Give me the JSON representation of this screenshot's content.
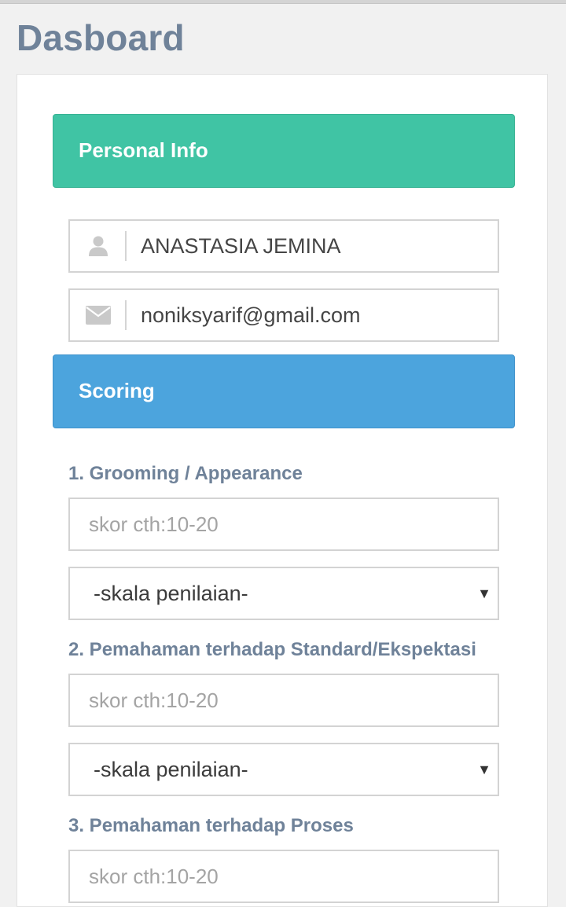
{
  "page": {
    "title": "Dasboard"
  },
  "personal_info": {
    "header": "Personal Info",
    "name_icon": "user-icon",
    "name_value": "ANASTASIA JEMINA",
    "email_icon": "envelope-icon",
    "email_value": "noniksyarif@gmail.com"
  },
  "scoring": {
    "header": "Scoring",
    "questions": [
      {
        "label": "1. Grooming / Appearance",
        "score_placeholder": "skor cth:10-20",
        "scale_selected": "-skala penilaian-"
      },
      {
        "label": "2. Pemahaman terhadap Standard/Ekspektasi",
        "score_placeholder": "skor cth:10-20",
        "scale_selected": "-skala penilaian-"
      },
      {
        "label": "3. Pemahaman terhadap Proses",
        "score_placeholder": "skor cth:10-20"
      }
    ],
    "dropdown_arrow": "▼"
  },
  "colors": {
    "title_text": "#6f8299",
    "personal_header_bg": "#40c4a4",
    "scoring_header_bg": "#4ca4dd",
    "card_bg": "#ffffff",
    "page_bg": "#f1f1f1"
  }
}
